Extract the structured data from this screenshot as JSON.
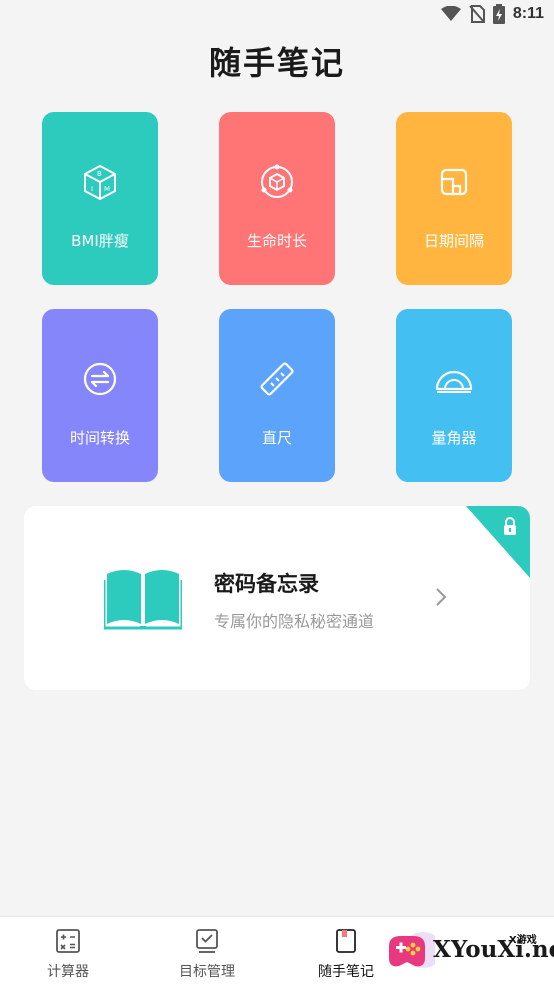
{
  "status_bar": {
    "time": "8:11",
    "icons": [
      "wifi-icon",
      "no-sim-icon",
      "battery-icon"
    ]
  },
  "title": "随手笔记",
  "tools": [
    {
      "label": "BMI胖瘦",
      "icon": "bmi-cube-icon",
      "color": "#2ccbbe"
    },
    {
      "label": "生命时长",
      "icon": "life-cube-icon",
      "color": "#ff7474"
    },
    {
      "label": "日期间隔",
      "icon": "date-interval-icon",
      "color": "#ffb53f"
    },
    {
      "label": "时间转换",
      "icon": "time-convert-icon",
      "color": "#8686fb"
    },
    {
      "label": "直尺",
      "icon": "ruler-icon",
      "color": "#5ba3fb"
    },
    {
      "label": "量角器",
      "icon": "protractor-icon",
      "color": "#44bff2"
    }
  ],
  "memo_card": {
    "title": "密码备忘录",
    "subtitle": "专属你的隐私秘密通道",
    "icon": "open-book-icon",
    "corner_icon": "lock-icon",
    "accent": "#2ccbbe"
  },
  "bottom_nav": [
    {
      "label": "计算器",
      "icon": "calculator-icon"
    },
    {
      "label": "目标管理",
      "icon": "checklist-icon"
    },
    {
      "label": "随手笔记",
      "icon": "notebook-icon",
      "active": true
    }
  ],
  "watermark": {
    "brand": "XYouXi.net",
    "small": "X游戏"
  }
}
